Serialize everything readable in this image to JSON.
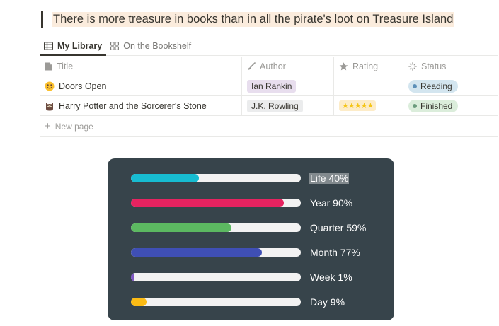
{
  "quote": "There is more treasure in books than in all the pirate's loot on Treasure Island",
  "tabs": [
    {
      "label": "My Library",
      "icon": "table-icon",
      "active": true
    },
    {
      "label": "On the Bookshelf",
      "icon": "gallery-icon",
      "active": false
    }
  ],
  "columns": {
    "title": "Title",
    "author": "Author",
    "rating": "Rating",
    "status": "Status"
  },
  "rows": [
    {
      "emoji": "smiley-emoji",
      "title": "Doors Open",
      "author": "Ian Rankin",
      "rating": "",
      "status": "Reading",
      "status_color": "#d3e5ef",
      "dot_color": "#5c8fb8"
    },
    {
      "emoji": "owl-emoji",
      "title": "Harry Potter and the Sorcerer's Stone",
      "author": "J.K. Rowling",
      "rating": "★★★★★",
      "status": "Finished",
      "status_color": "#dbeddb",
      "dot_color": "#6c9b7d"
    }
  ],
  "new_page_label": "New page",
  "progress": [
    {
      "label": "Life 40%",
      "value": 0.4,
      "color": "#17bcd1",
      "highlighted": true
    },
    {
      "label": "Year 90%",
      "value": 0.9,
      "color": "#e62360",
      "highlighted": false
    },
    {
      "label": "Quarter 59%",
      "value": 0.59,
      "color": "#5cb961",
      "highlighted": false
    },
    {
      "label": "Month 77%",
      "value": 0.77,
      "color": "#3f4fb5",
      "highlighted": false
    },
    {
      "label": "Week 1%",
      "value": 0.01,
      "color": "#7e57c2",
      "highlighted": false
    },
    {
      "label": "Day 9%",
      "value": 0.09,
      "color": "#fbbb14",
      "highlighted": false
    }
  ]
}
